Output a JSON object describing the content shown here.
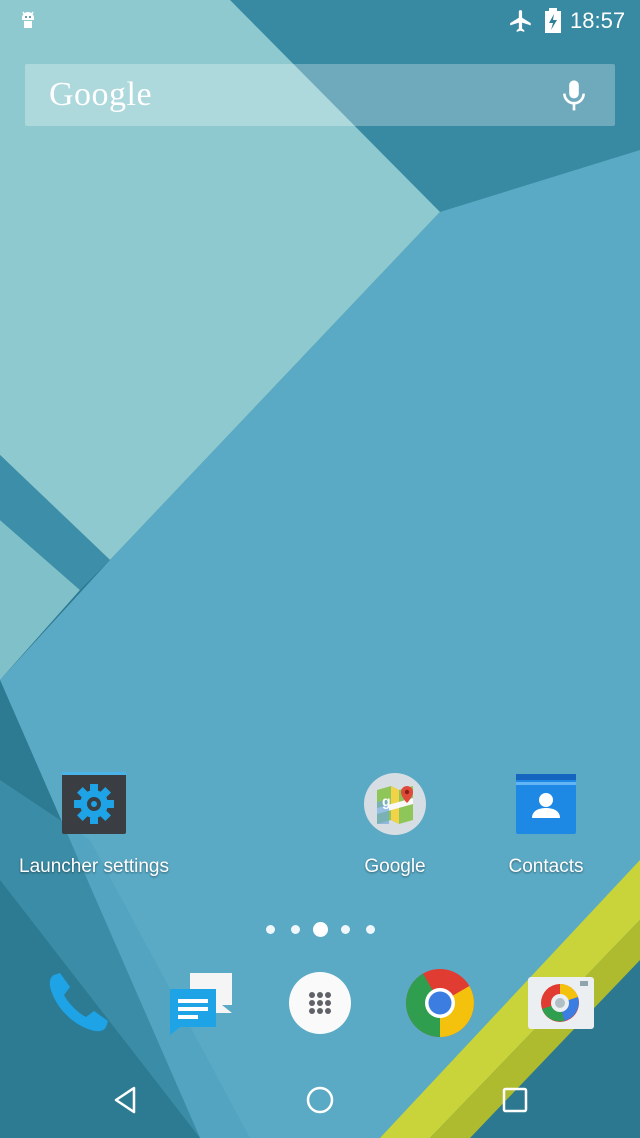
{
  "status_bar": {
    "time": "18:57",
    "icons": [
      "android-icon",
      "airplane-mode-icon",
      "battery-charging-icon"
    ]
  },
  "search_bar": {
    "logo_text": "Google",
    "mic_icon": "mic-icon"
  },
  "apps": [
    {
      "label": "Launcher settings",
      "icon": "gear-icon"
    },
    {
      "label": "Google",
      "icon": "maps-icon"
    },
    {
      "label": "Contacts",
      "icon": "contacts-icon"
    }
  ],
  "page_indicator": {
    "pages": 5,
    "current": 3
  },
  "dock": [
    {
      "icon": "phone-icon"
    },
    {
      "icon": "messaging-icon"
    },
    {
      "icon": "app-drawer-icon"
    },
    {
      "icon": "chrome-icon"
    },
    {
      "icon": "camera-icon"
    }
  ],
  "nav_bar": {
    "buttons": [
      "back-icon",
      "home-icon",
      "recents-icon"
    ]
  },
  "colors": {
    "wallpaper_light": "#8ec9cf",
    "wallpaper_mid": "#58a8c6",
    "wallpaper_dark": "#2f7f98",
    "accent_yellow": "#c7d23a"
  }
}
